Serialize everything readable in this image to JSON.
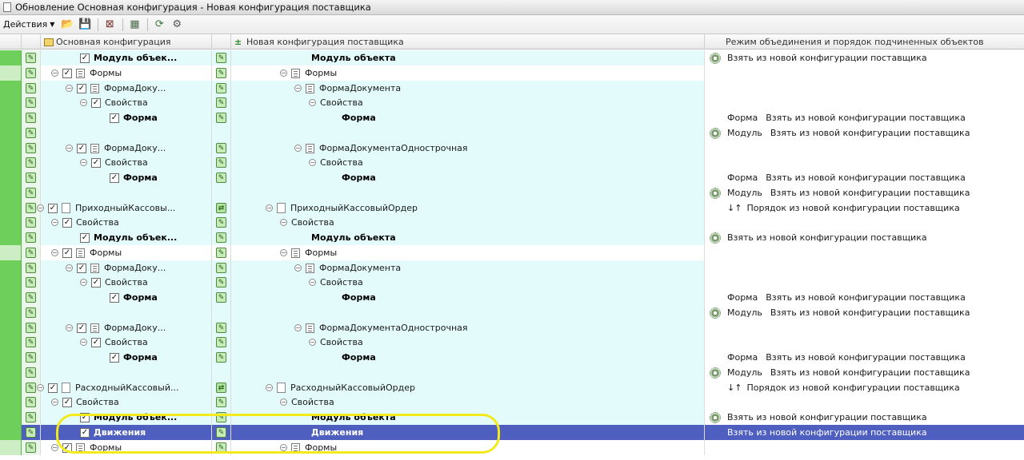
{
  "window": {
    "title": "Обновление Основная конфигурация - Новая конфигурация поставщика"
  },
  "toolbar": {
    "actions_label": "Действия",
    "icons": [
      "folder-up-icon",
      "save-icon",
      "filter-clear-icon",
      "compare-icon",
      "refresh-icon",
      "settings-icon"
    ]
  },
  "columns": {
    "main": "Основная конфигурация",
    "vendor": "Новая конфигурация поставщика",
    "mode": "Режим объединения и порядок подчиненных объектов"
  },
  "rows": [
    {
      "c1": "Модуль объек...",
      "c2": "Модуль объекта",
      "mode": "Взять из новой конфигурации поставщика"
    },
    {
      "c1": "Формы",
      "c2": "Формы",
      "mode": ""
    },
    {
      "c1": "ФормаДоку...",
      "c2": "ФормаДокумента",
      "mode": ""
    },
    {
      "c1": "Свойства",
      "c2": "Свойства",
      "mode": ""
    },
    {
      "c1": "Форма",
      "c2": "Форма",
      "mode_a": "Форма",
      "mode_b": "Взять из новой конфигурации поставщика"
    },
    {
      "c1": "",
      "c2": "",
      "mode_a": "Модуль",
      "mode_b": "Взять из новой конфигурации поставщика"
    },
    {
      "c1": "ФормаДоку...",
      "c2": "ФормаДокументаОднострочная",
      "mode": ""
    },
    {
      "c1": "Свойства",
      "c2": "Свойства",
      "mode": ""
    },
    {
      "c1": "Форма",
      "c2": "Форма",
      "mode_a": "Форма",
      "mode_b": "Взять из новой конфигурации поставщика"
    },
    {
      "c1": "",
      "c2": "",
      "mode_a": "Модуль",
      "mode_b": "Взять из новой конфигурации поставщика"
    },
    {
      "c1": "ПриходныйКассовы...",
      "c2": "ПриходныйКассовыйОрдер",
      "mode_sort": "↓↑",
      "mode": "Порядок из новой конфигурации поставщика"
    },
    {
      "c1": "Свойства",
      "c2": "Свойства",
      "mode": ""
    },
    {
      "c1": "Модуль объек...",
      "c2": "Модуль объекта",
      "mode": "Взять из новой конфигурации поставщика"
    },
    {
      "c1": "Формы",
      "c2": "Формы",
      "mode": ""
    },
    {
      "c1": "ФормаДоку...",
      "c2": "ФормаДокумента",
      "mode": ""
    },
    {
      "c1": "Свойства",
      "c2": "Свойства",
      "mode": ""
    },
    {
      "c1": "Форма",
      "c2": "Форма",
      "mode_a": "Форма",
      "mode_b": "Взять из новой конфигурации поставщика"
    },
    {
      "c1": "",
      "c2": "",
      "mode_a": "Модуль",
      "mode_b": "Взять из новой конфигурации поставщика"
    },
    {
      "c1": "ФормаДоку...",
      "c2": "ФормаДокументаОднострочная",
      "mode": ""
    },
    {
      "c1": "Свойства",
      "c2": "Свойства",
      "mode": ""
    },
    {
      "c1": "Форма",
      "c2": "Форма",
      "mode_a": "Форма",
      "mode_b": "Взять из новой конфигурации поставщика"
    },
    {
      "c1": "",
      "c2": "",
      "mode_a": "Модуль",
      "mode_b": "Взять из новой конфигурации поставщика"
    },
    {
      "c1": "РасходныйКассовый...",
      "c2": "РасходныйКассовыйОрдер",
      "mode_sort": "↓↑",
      "mode": "Порядок из новой конфигурации поставщика"
    },
    {
      "c1": "Свойства",
      "c2": "Свойства",
      "mode": ""
    },
    {
      "c1": "Модуль объек...",
      "c2": "Модуль объекта",
      "mode": "Взять из новой конфигурации поставщика"
    },
    {
      "c1": "Движения",
      "c2": "Движения",
      "mode": "Взять из новой конфигурации поставщика"
    },
    {
      "c1": "Формы",
      "c2": "Формы",
      "mode": ""
    }
  ],
  "colors": {
    "green_strip": "#6fcf5b",
    "row_cyan": "#e3fbfb",
    "selection": "#4e5fc0",
    "highlight": "#f2ea1c"
  }
}
